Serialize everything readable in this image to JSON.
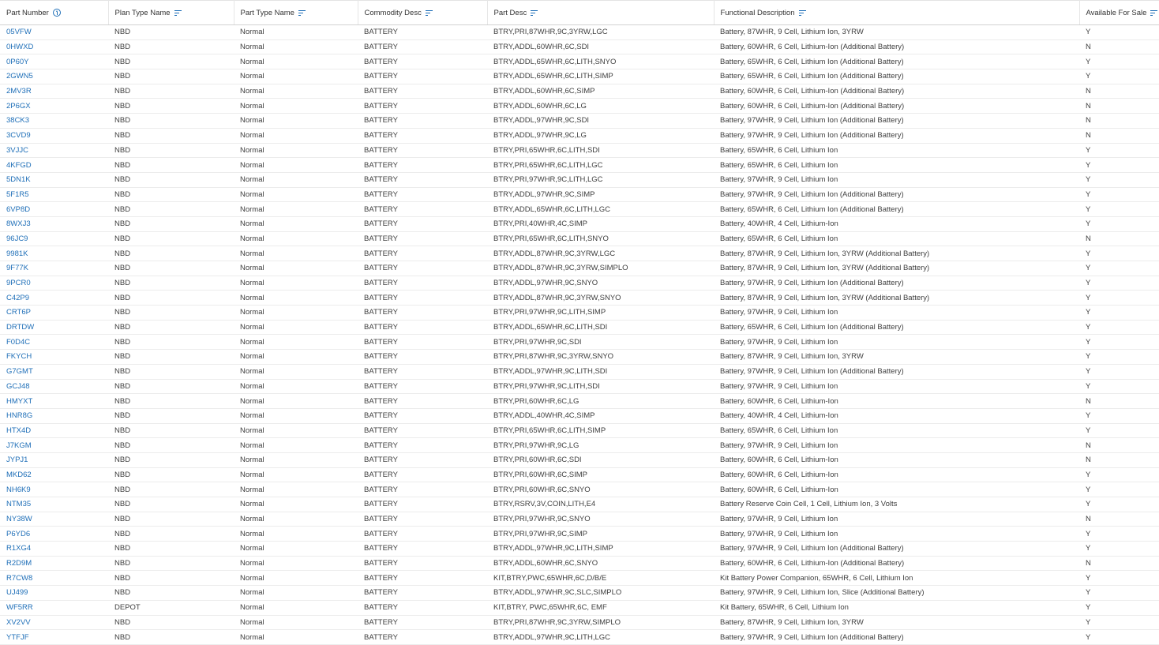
{
  "columns": [
    {
      "label": "Part Number",
      "icon": "sort-ascending-icon"
    },
    {
      "label": "Plan Type Name",
      "icon": "filter-icon"
    },
    {
      "label": "Part Type Name",
      "icon": "filter-icon"
    },
    {
      "label": "Commodity Desc",
      "icon": "filter-icon"
    },
    {
      "label": "Part Desc",
      "icon": "filter-icon"
    },
    {
      "label": "Functional Description",
      "icon": "filter-icon"
    },
    {
      "label": "Available For Sale",
      "icon": "filter-icon"
    }
  ],
  "colors": {
    "link": "#1f6fb8",
    "text": "#404040",
    "border": "#ececec"
  },
  "rows": [
    [
      "05VFW",
      "NBD",
      "Normal",
      "BATTERY",
      "BTRY,PRI,87WHR,9C,3YRW,LGC",
      "Battery, 87WHR, 9 Cell, Lithium Ion, 3YRW",
      "Y"
    ],
    [
      "0HWXD",
      "NBD",
      "Normal",
      "BATTERY",
      "BTRY,ADDL,60WHR,6C,SDI",
      "Battery, 60WHR, 6 Cell, Lithium-Ion (Additional Battery)",
      "N"
    ],
    [
      "0P60Y",
      "NBD",
      "Normal",
      "BATTERY",
      "BTRY,ADDL,65WHR,6C,LITH,SNYO",
      "Battery, 65WHR, 6 Cell, Lithium Ion (Additional Battery)",
      "Y"
    ],
    [
      "2GWN5",
      "NBD",
      "Normal",
      "BATTERY",
      "BTRY,ADDL,65WHR,6C,LITH,SIMP",
      "Battery, 65WHR, 6 Cell, Lithium Ion (Additional Battery)",
      "Y"
    ],
    [
      "2MV3R",
      "NBD",
      "Normal",
      "BATTERY",
      "BTRY,ADDL,60WHR,6C,SIMP",
      "Battery, 60WHR, 6 Cell, Lithium-Ion (Additional Battery)",
      "N"
    ],
    [
      "2P6GX",
      "NBD",
      "Normal",
      "BATTERY",
      "BTRY,ADDL,60WHR,6C,LG",
      "Battery, 60WHR, 6 Cell, Lithium-Ion (Additional Battery)",
      "N"
    ],
    [
      "38CK3",
      "NBD",
      "Normal",
      "BATTERY",
      "BTRY,ADDL,97WHR,9C,SDI",
      "Battery, 97WHR, 9 Cell, Lithium Ion (Additional Battery)",
      "N"
    ],
    [
      "3CVD9",
      "NBD",
      "Normal",
      "BATTERY",
      "BTRY,ADDL,97WHR,9C,LG",
      "Battery, 97WHR, 9 Cell, Lithium Ion (Additional Battery)",
      "N"
    ],
    [
      "3VJJC",
      "NBD",
      "Normal",
      "BATTERY",
      "BTRY,PRI,65WHR,6C,LITH,SDI",
      "Battery, 65WHR, 6 Cell, Lithium Ion",
      "Y"
    ],
    [
      "4KFGD",
      "NBD",
      "Normal",
      "BATTERY",
      "BTRY,PRI,65WHR,6C,LITH,LGC",
      "Battery, 65WHR, 6 Cell, Lithium Ion",
      "Y"
    ],
    [
      "5DN1K",
      "NBD",
      "Normal",
      "BATTERY",
      "BTRY,PRI,97WHR,9C,LITH,LGC",
      "Battery, 97WHR, 9 Cell, Lithium Ion",
      "Y"
    ],
    [
      "5F1R5",
      "NBD",
      "Normal",
      "BATTERY",
      "BTRY,ADDL,97WHR,9C,SIMP",
      "Battery, 97WHR, 9 Cell, Lithium Ion (Additional Battery)",
      "Y"
    ],
    [
      "6VP8D",
      "NBD",
      "Normal",
      "BATTERY",
      "BTRY,ADDL,65WHR,6C,LITH,LGC",
      "Battery, 65WHR, 6 Cell, Lithium Ion (Additional Battery)",
      "Y"
    ],
    [
      "8WXJ3",
      "NBD",
      "Normal",
      "BATTERY",
      "BTRY,PRI,40WHR,4C,SIMP",
      "Battery, 40WHR, 4 Cell, Lithium-Ion",
      "Y"
    ],
    [
      "96JC9",
      "NBD",
      "Normal",
      "BATTERY",
      "BTRY,PRI,65WHR,6C,LITH,SNYO",
      "Battery, 65WHR, 6 Cell, Lithium Ion",
      "N"
    ],
    [
      "9981K",
      "NBD",
      "Normal",
      "BATTERY",
      "BTRY,ADDL,87WHR,9C,3YRW,LGC",
      "Battery, 87WHR, 9 Cell, Lithium Ion, 3YRW (Additional Battery)",
      "Y"
    ],
    [
      "9F77K",
      "NBD",
      "Normal",
      "BATTERY",
      "BTRY,ADDL,87WHR,9C,3YRW,SIMPLO",
      "Battery, 87WHR, 9 Cell, Lithium Ion, 3YRW (Additional Battery)",
      "Y"
    ],
    [
      "9PCR0",
      "NBD",
      "Normal",
      "BATTERY",
      "BTRY,ADDL,97WHR,9C,SNYO",
      "Battery, 97WHR, 9 Cell, Lithium Ion (Additional Battery)",
      "Y"
    ],
    [
      "C42P9",
      "NBD",
      "Normal",
      "BATTERY",
      "BTRY,ADDL,87WHR,9C,3YRW,SNYO",
      "Battery, 87WHR, 9 Cell, Lithium Ion, 3YRW (Additional Battery)",
      "Y"
    ],
    [
      "CRT6P",
      "NBD",
      "Normal",
      "BATTERY",
      "BTRY,PRI,97WHR,9C,LITH,SIMP",
      "Battery, 97WHR, 9 Cell, Lithium Ion",
      "Y"
    ],
    [
      "DRTDW",
      "NBD",
      "Normal",
      "BATTERY",
      "BTRY,ADDL,65WHR,6C,LITH,SDI",
      "Battery, 65WHR, 6 Cell, Lithium Ion (Additional Battery)",
      "Y"
    ],
    [
      "F0D4C",
      "NBD",
      "Normal",
      "BATTERY",
      "BTRY,PRI,97WHR,9C,SDI",
      "Battery, 97WHR, 9 Cell, Lithium Ion",
      "Y"
    ],
    [
      "FKYCH",
      "NBD",
      "Normal",
      "BATTERY",
      "BTRY,PRI,87WHR,9C,3YRW,SNYO",
      "Battery, 87WHR, 9 Cell, Lithium Ion, 3YRW",
      "Y"
    ],
    [
      "G7GMT",
      "NBD",
      "Normal",
      "BATTERY",
      "BTRY,ADDL,97WHR,9C,LITH,SDI",
      "Battery, 97WHR, 9 Cell, Lithium Ion (Additional Battery)",
      "Y"
    ],
    [
      "GCJ48",
      "NBD",
      "Normal",
      "BATTERY",
      "BTRY,PRI,97WHR,9C,LITH,SDI",
      "Battery, 97WHR, 9 Cell, Lithium Ion",
      "Y"
    ],
    [
      "HMYXT",
      "NBD",
      "Normal",
      "BATTERY",
      "BTRY,PRI,60WHR,6C,LG",
      "Battery, 60WHR, 6 Cell, Lithium-Ion",
      "N"
    ],
    [
      "HNR8G",
      "NBD",
      "Normal",
      "BATTERY",
      "BTRY,ADDL,40WHR,4C,SIMP",
      "Battery, 40WHR, 4 Cell, Lithium-Ion",
      "Y"
    ],
    [
      "HTX4D",
      "NBD",
      "Normal",
      "BATTERY",
      "BTRY,PRI,65WHR,6C,LITH,SIMP",
      "Battery, 65WHR, 6 Cell, Lithium Ion",
      "Y"
    ],
    [
      "J7KGM",
      "NBD",
      "Normal",
      "BATTERY",
      "BTRY,PRI,97WHR,9C,LG",
      "Battery, 97WHR, 9 Cell, Lithium Ion",
      "N"
    ],
    [
      "JYPJ1",
      "NBD",
      "Normal",
      "BATTERY",
      "BTRY,PRI,60WHR,6C,SDI",
      "Battery, 60WHR, 6 Cell, Lithium-Ion",
      "N"
    ],
    [
      "MKD62",
      "NBD",
      "Normal",
      "BATTERY",
      "BTRY,PRI,60WHR,6C,SIMP",
      "Battery, 60WHR, 6 Cell, Lithium-Ion",
      "Y"
    ],
    [
      "NH6K9",
      "NBD",
      "Normal",
      "BATTERY",
      "BTRY,PRI,60WHR,6C,SNYO",
      "Battery, 60WHR, 6 Cell, Lithium-Ion",
      "Y"
    ],
    [
      "NTM35",
      "NBD",
      "Normal",
      "BATTERY",
      "BTRY,RSRV,3V,COIN,LITH,E4",
      "Battery Reserve Coin Cell, 1 Cell, Lithium Ion, 3 Volts",
      "Y"
    ],
    [
      "NY38W",
      "NBD",
      "Normal",
      "BATTERY",
      "BTRY,PRI,97WHR,9C,SNYO",
      "Battery, 97WHR, 9 Cell, Lithium Ion",
      "N"
    ],
    [
      "P6YD6",
      "NBD",
      "Normal",
      "BATTERY",
      "BTRY,PRI,97WHR,9C,SIMP",
      "Battery, 97WHR, 9 Cell, Lithium Ion",
      "Y"
    ],
    [
      "R1XG4",
      "NBD",
      "Normal",
      "BATTERY",
      "BTRY,ADDL,97WHR,9C,LITH,SIMP",
      "Battery, 97WHR, 9 Cell, Lithium Ion (Additional Battery)",
      "Y"
    ],
    [
      "R2D9M",
      "NBD",
      "Normal",
      "BATTERY",
      "BTRY,ADDL,60WHR,6C,SNYO",
      "Battery, 60WHR, 6 Cell, Lithium-Ion (Additional Battery)",
      "N"
    ],
    [
      "R7CW8",
      "NBD",
      "Normal",
      "BATTERY",
      "KIT,BTRY,PWC,65WHR,6C,D/B/E",
      "Kit Battery Power Companion, 65WHR, 6 Cell, Lithium Ion",
      "Y"
    ],
    [
      "UJ499",
      "NBD",
      "Normal",
      "BATTERY",
      "BTRY,ADDL,97WHR,9C,SLC,SIMPLO",
      "Battery, 97WHR, 9 Cell, Lithium Ion, Slice (Additional Battery)",
      "Y"
    ],
    [
      "WF5RR",
      "DEPOT",
      "Normal",
      "BATTERY",
      "KIT,BTRY, PWC,65WHR,6C, EMF",
      "Kit Battery, 65WHR, 6 Cell, Lithium Ion",
      "Y"
    ],
    [
      "XV2VV",
      "NBD",
      "Normal",
      "BATTERY",
      "BTRY,PRI,87WHR,9C,3YRW,SIMPLO",
      "Battery, 87WHR, 9 Cell, Lithium Ion, 3YRW",
      "Y"
    ],
    [
      "YTFJF",
      "NBD",
      "Normal",
      "BATTERY",
      "BTRY,ADDL,97WHR,9C,LITH,LGC",
      "Battery, 97WHR, 9 Cell, Lithium Ion (Additional Battery)",
      "Y"
    ]
  ]
}
